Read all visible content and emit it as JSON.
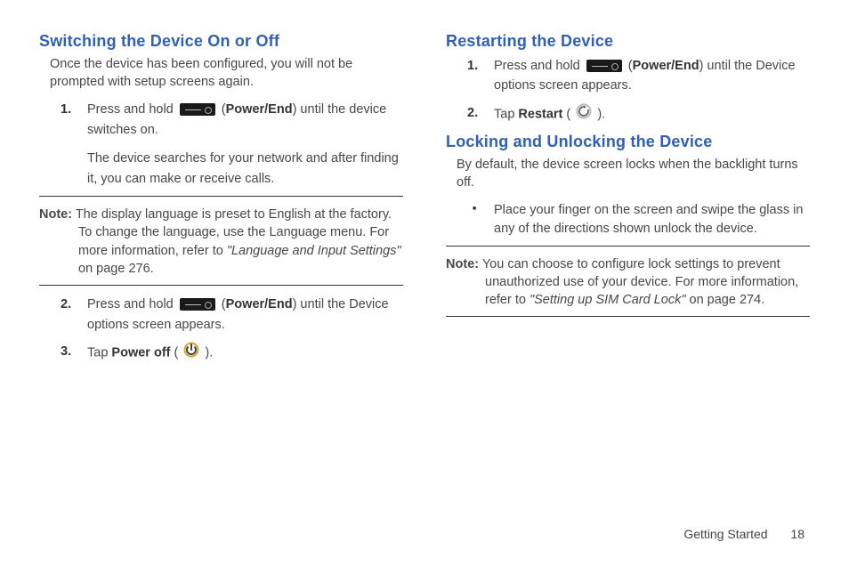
{
  "left": {
    "heading1": "Switching the Device On or Off",
    "intro": "Once the device has been configured, you will not be prompted with setup screens again.",
    "step1_a": "Press and hold ",
    "step1_b": "(",
    "step1_key": "Power/End",
    "step1_c": ") until the device switches on.",
    "step1_sub": "The device searches for your network and after finding it, you can make or receive calls.",
    "note1_label": "Note:",
    "note1_body_a": " The display language is preset to English at the factory. To change the language, use the Language menu. For more information, refer to ",
    "note1_ref": "\"Language and Input Settings\"",
    "note1_body_b": "  on page 276.",
    "step2_a": "Press and hold ",
    "step2_b": "(",
    "step2_key": "Power/End",
    "step2_c": ") until the Device options screen appears.",
    "step3_a": "Tap ",
    "step3_key": "Power off",
    "step3_b": " ( ",
    "step3_c": " )."
  },
  "right": {
    "heading1": "Restarting the Device",
    "step1_a": "Press and hold ",
    "step1_b": "(",
    "step1_key": "Power/End",
    "step1_c": ") until the Device options screen appears.",
    "step2_a": "Tap ",
    "step2_key": "Restart",
    "step2_b": " ( ",
    "step2_c": " ).",
    "heading2": "Locking and Unlocking the Device",
    "intro2": "By default, the device screen locks when the backlight turns off.",
    "bullet1": "Place your finger on the screen and swipe the glass in any of the directions shown unlock the device.",
    "note1_label": "Note:",
    "note1_body_a": " You can choose to configure lock settings to prevent unauthorized use of your device. For more information, refer to ",
    "note1_ref": "\"Setting up SIM Card Lock\"",
    "note1_body_b": "  on page 274."
  },
  "footer": {
    "section": "Getting Started",
    "page": "18"
  }
}
